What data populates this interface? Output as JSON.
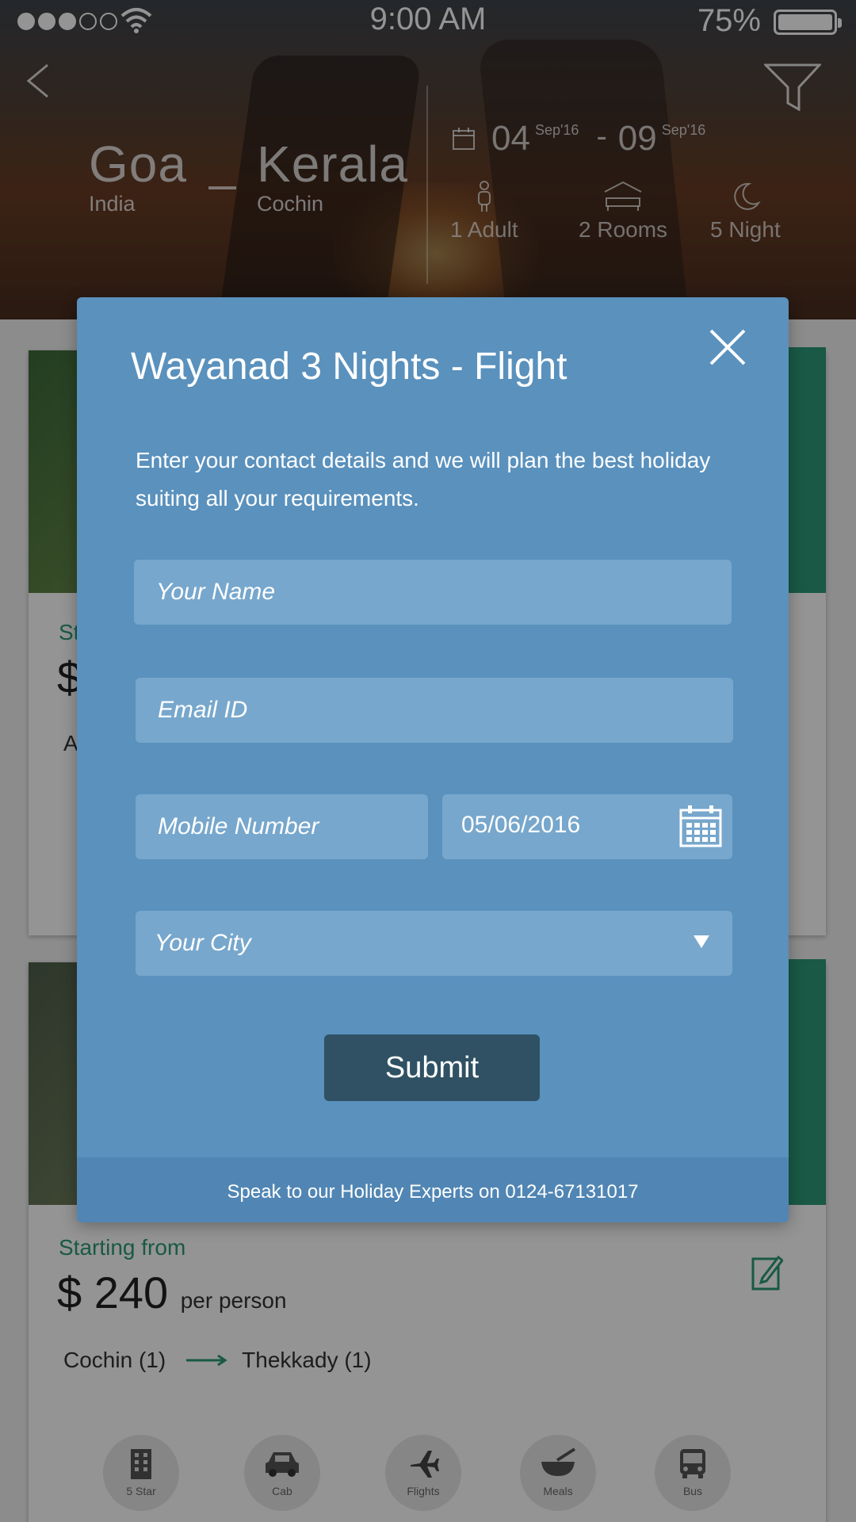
{
  "status_bar": {
    "time": "9:00 AM",
    "battery": "75%",
    "signal_full": 3,
    "signal_total": 5
  },
  "header": {
    "origin": {
      "name": "Goa",
      "sub": "India"
    },
    "separator": "_",
    "destination": {
      "name": "Kerala",
      "sub": "Cochin"
    },
    "start_day": "04",
    "start_month": "Sep'16",
    "date_separator": "-",
    "end_day": "09",
    "end_month": "Sep'16",
    "adults": "1 Adult",
    "rooms": "2 Rooms",
    "nights": "5 Night"
  },
  "cards": [
    {
      "from_label": "St",
      "price": "$",
      "route_partial": "Al"
    },
    {
      "from_label": "Starting  from",
      "price": "$ 240",
      "per": "per person",
      "route_from": "Cochin (1)",
      "route_to": "Thekkady (1)",
      "amenities": [
        "5 Star",
        "Cab",
        "Flights",
        "Meals",
        "Bus"
      ]
    }
  ],
  "modal": {
    "title": "Wayanad 3 Nights - Flight",
    "description": "Enter your contact details and we will plan the best holiday suiting all your requirements.",
    "name_placeholder": "Your Name",
    "email_placeholder": "Email ID",
    "mobile_placeholder": "Mobile Number",
    "date_value": "05/06/2016",
    "city_placeholder": "Your City",
    "submit_label": "Submit",
    "footer": "Speak to our Holiday Experts on 0124-67131017"
  },
  "colors": {
    "accent_green": "#2c9a78",
    "modal_bg": "#5a91bd",
    "field_bg": "#77a7cc",
    "submit_bg": "#2f5163"
  }
}
